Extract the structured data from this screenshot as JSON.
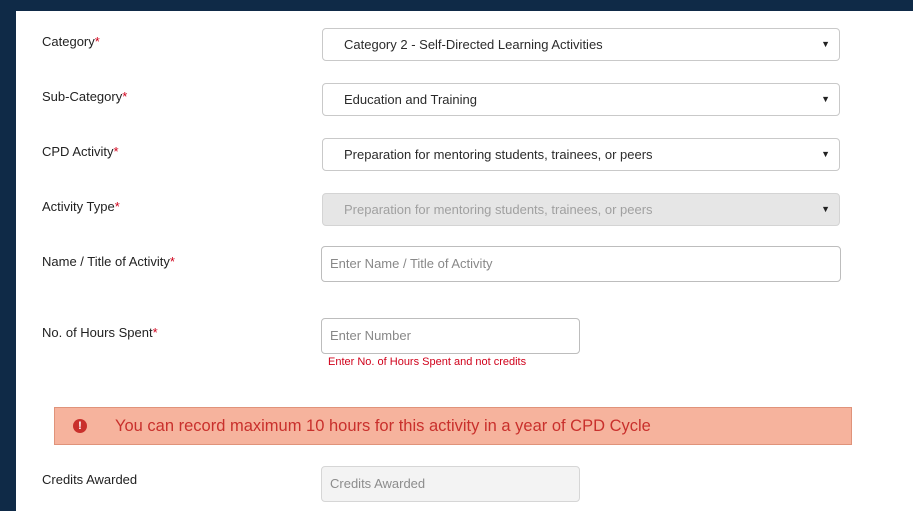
{
  "form": {
    "category": {
      "label": "Category",
      "value": "Category 2 - Self-Directed Learning Activities"
    },
    "sub_category": {
      "label": "Sub-Category",
      "value": "Education and Training"
    },
    "cpd_activity": {
      "label": "CPD Activity",
      "value": "Preparation for mentoring students, trainees, or peers"
    },
    "activity_type": {
      "label": "Activity Type",
      "value": "Preparation for mentoring students, trainees, or peers"
    },
    "name_title": {
      "label": "Name / Title of Activity",
      "placeholder": "Enter Name / Title of Activity"
    },
    "hours": {
      "label": "No. of Hours Spent",
      "placeholder": "Enter Number",
      "hint": "Enter No. of Hours Spent and not credits"
    },
    "credits": {
      "label": "Credits Awarded",
      "placeholder": "Credits Awarded"
    },
    "required_mark": "*"
  },
  "alert": {
    "icon": "exclamation-circle-icon",
    "text": "You can record maximum 10 hours for this activity in a year of CPD Cycle"
  },
  "colors": {
    "required": "#d0021b",
    "alert_background": "#f6b39d",
    "alert_text": "#c9302c",
    "page_background": "#0f2a47"
  }
}
